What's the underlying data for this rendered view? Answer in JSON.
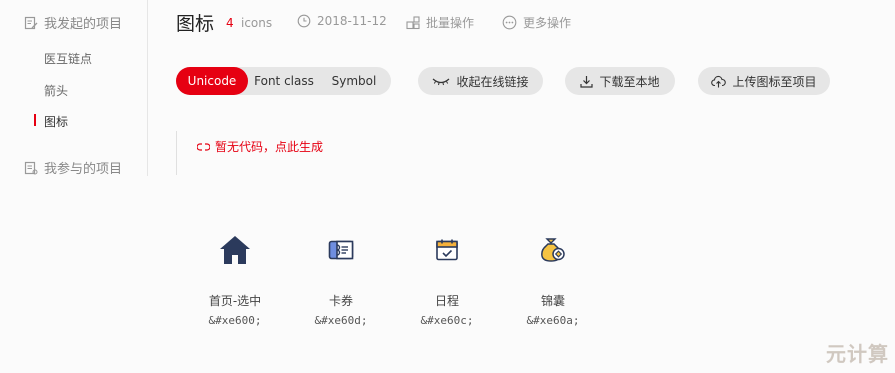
{
  "sidebar": {
    "my_projects": "我发起的项目",
    "items": [
      {
        "label": "医互链点"
      },
      {
        "label": "箭头"
      },
      {
        "label": "图标"
      }
    ],
    "joined_projects": "我参与的项目"
  },
  "header": {
    "title": "图标",
    "icon_count": "4",
    "icon_count_unit": "icons",
    "date": "2018-11-12",
    "batch_ops": "批量操作",
    "more_ops": "更多操作"
  },
  "toolbar": {
    "tabs": [
      "Unicode",
      "Font class",
      "Symbol"
    ],
    "active_tab": "Unicode",
    "collapse_link": "收起在线链接",
    "download": "下载至本地",
    "upload": "上传图标至项目"
  },
  "notice": {
    "text": "暂无代码，点此生成"
  },
  "icons": [
    {
      "name": "首页-选中",
      "code": "&#xe600;",
      "icon": "home-icon"
    },
    {
      "name": "卡券",
      "code": "&#xe60d;",
      "icon": "ticket-icon"
    },
    {
      "name": "日程",
      "code": "&#xe60c;",
      "icon": "calendar-icon"
    },
    {
      "name": "锦囊",
      "code": "&#xe60a;",
      "icon": "money-bag-icon"
    }
  ],
  "watermark": "元计算",
  "colors": {
    "accent": "#e60012",
    "pill_bg": "#e6e6e6",
    "home_icon": "#2b3a5c",
    "ticket_icon": "#5b7bd6",
    "calendar_icon": "#f5b13b",
    "bag_icon": "#f5c342"
  }
}
